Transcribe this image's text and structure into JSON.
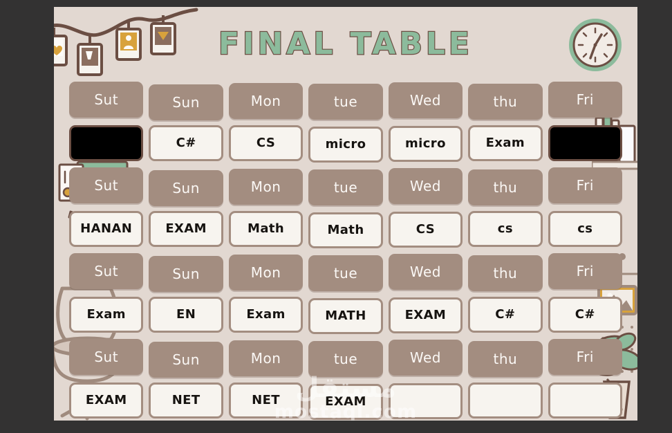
{
  "poster": {
    "title": "FINAL TABLE",
    "background_color": "#e2d8d1",
    "accent_green": "#8cbb9c",
    "accent_brown": "#6b4e43",
    "header_color": "#a38d80",
    "cell_color": "#f7f4ef"
  },
  "watermark": {
    "arabic": "مستقل",
    "latin": "mostaql.com"
  },
  "clock": {
    "name": "wall-clock",
    "hour": "1",
    "minute": "35"
  },
  "decorations": [
    {
      "name": "photo-garland"
    },
    {
      "name": "wall-clock"
    },
    {
      "name": "sticky-notes"
    },
    {
      "name": "green-box"
    },
    {
      "name": "pencil"
    },
    {
      "name": "desk-chair"
    },
    {
      "name": "bookshelf"
    },
    {
      "name": "picture-frame"
    },
    {
      "name": "dotted-notepad"
    },
    {
      "name": "potted-plant"
    }
  ],
  "table": {
    "days": [
      "Sut",
      "Sun",
      "Mon",
      "tue",
      "Wed",
      "thu",
      "Fri"
    ],
    "blocks": [
      {
        "days": [
          "Sut",
          "Sun",
          "Mon",
          "tue",
          "Wed",
          "thu",
          "Fri"
        ],
        "entries": [
          {
            "text": "",
            "redacted": true
          },
          {
            "text": "C#",
            "redacted": false
          },
          {
            "text": "CS",
            "redacted": false
          },
          {
            "text": "micro",
            "redacted": false
          },
          {
            "text": "micro",
            "redacted": false
          },
          {
            "text": "Exam",
            "redacted": false
          },
          {
            "text": "",
            "redacted": true
          }
        ]
      },
      {
        "days": [
          "Sut",
          "Sun",
          "Mon",
          "tue",
          "Wed",
          "thu",
          "Fri"
        ],
        "entries": [
          {
            "text": "HANAN",
            "redacted": false
          },
          {
            "text": "EXAM",
            "redacted": false
          },
          {
            "text": "Math",
            "redacted": false
          },
          {
            "text": "Math",
            "redacted": false
          },
          {
            "text": "CS",
            "redacted": false
          },
          {
            "text": "cs",
            "redacted": false
          },
          {
            "text": "cs",
            "redacted": false
          }
        ]
      },
      {
        "days": [
          "Sut",
          "Sun",
          "Mon",
          "tue",
          "Wed",
          "thu",
          "Fri"
        ],
        "entries": [
          {
            "text": "Exam",
            "redacted": false
          },
          {
            "text": "EN",
            "redacted": false
          },
          {
            "text": "Exam",
            "redacted": false
          },
          {
            "text": "MATH",
            "redacted": false
          },
          {
            "text": "EXAM",
            "redacted": false
          },
          {
            "text": "C#",
            "redacted": false
          },
          {
            "text": "C#",
            "redacted": false
          }
        ]
      },
      {
        "days": [
          "Sut",
          "Sun",
          "Mon",
          "tue",
          "Wed",
          "thu",
          "Fri"
        ],
        "entries": [
          {
            "text": "EXAM",
            "redacted": false
          },
          {
            "text": "NET",
            "redacted": false
          },
          {
            "text": "NET",
            "redacted": false
          },
          {
            "text": "EXAM",
            "redacted": false
          },
          {
            "text": "",
            "redacted": false
          },
          {
            "text": "",
            "redacted": false
          },
          {
            "text": "",
            "redacted": false
          }
        ]
      }
    ]
  }
}
